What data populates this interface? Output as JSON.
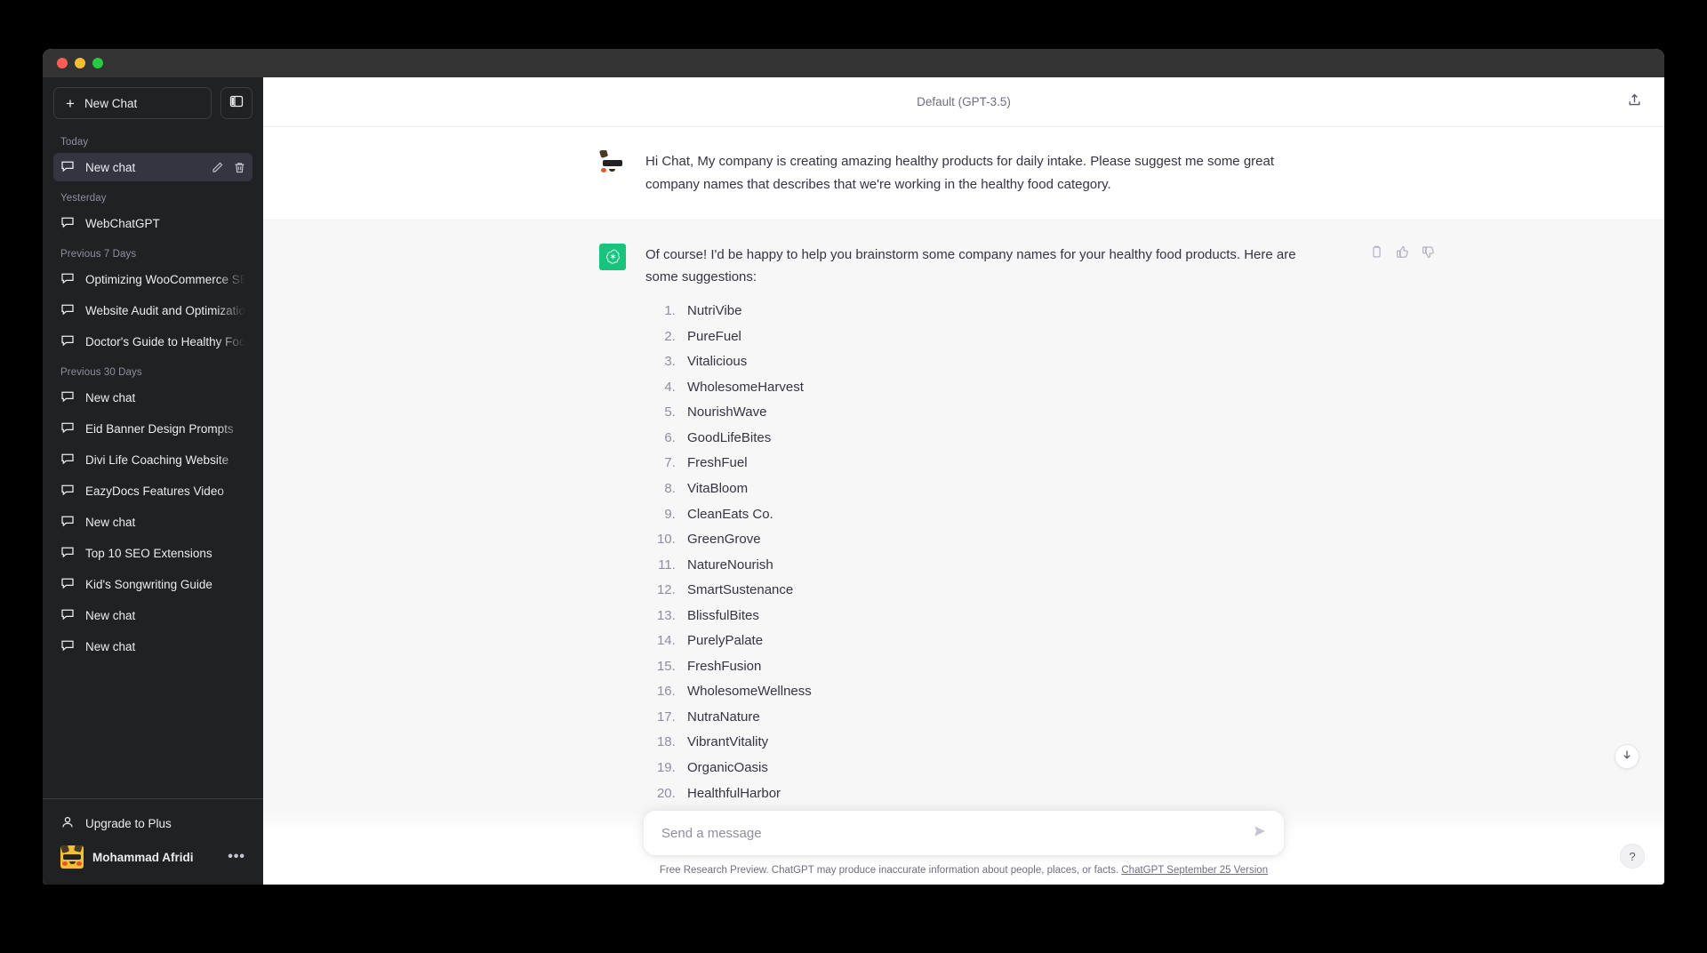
{
  "window": {
    "traffic_lights": [
      "close",
      "minimize",
      "maximize"
    ]
  },
  "sidebar": {
    "new_chat_label": "New Chat",
    "collapse_icon": "sidebar-toggle-icon",
    "sections": [
      {
        "label": "Today",
        "items": [
          {
            "title": "New chat",
            "active": true,
            "icon": "chat-bubble-icon"
          }
        ]
      },
      {
        "label": "Yesterday",
        "items": [
          {
            "title": "WebChatGPT",
            "active": false,
            "icon": "chat-bubble-icon"
          }
        ]
      },
      {
        "label": "Previous 7 Days",
        "items": [
          {
            "title": "Optimizing WooCommerce SEO Strategy",
            "active": false,
            "icon": "chat-bubble-icon"
          },
          {
            "title": "Website Audit and Optimization Plan",
            "active": false,
            "icon": "chat-bubble-icon"
          },
          {
            "title": "Doctor's Guide to Healthy Food",
            "active": false,
            "icon": "chat-bubble-icon"
          }
        ]
      },
      {
        "label": "Previous 30 Days",
        "items": [
          {
            "title": "New chat",
            "active": false,
            "icon": "chat-bubble-icon"
          },
          {
            "title": "Eid Banner Design Prompts",
            "active": false,
            "icon": "chat-bubble-icon"
          },
          {
            "title": "Divi Life Coaching Website",
            "active": false,
            "icon": "chat-bubble-icon"
          },
          {
            "title": "EazyDocs Features Video",
            "active": false,
            "icon": "chat-bubble-icon"
          },
          {
            "title": "New chat",
            "active": false,
            "icon": "chat-bubble-icon"
          },
          {
            "title": "Top 10 SEO Extensions",
            "active": false,
            "icon": "chat-bubble-icon"
          },
          {
            "title": "Kid's Songwriting Guide",
            "active": false,
            "icon": "chat-bubble-icon"
          },
          {
            "title": "New chat",
            "active": false,
            "icon": "chat-bubble-icon"
          },
          {
            "title": "New chat",
            "active": false,
            "icon": "chat-bubble-icon"
          }
        ]
      }
    ],
    "row_actions": [
      "edit-icon",
      "delete-icon"
    ],
    "footer": {
      "upgrade_label": "Upgrade to Plus",
      "upgrade_icon": "person-icon",
      "user_name": "Mohammad Afridi",
      "user_menu_icon": "ellipsis-icon"
    }
  },
  "header": {
    "model_title": "Default (GPT-3.5)",
    "share_icon": "share-upload-icon"
  },
  "conversation": {
    "messages": [
      {
        "role": "user",
        "avatar": "user-avatar",
        "text": "Hi Chat, My company is creating amazing healthy products for daily intake. Please suggest me some great company names that describes that we're working in the healthy food category."
      },
      {
        "role": "assistant",
        "avatar": "chatgpt-logo-icon",
        "text": "Of course! I'd be happy to help you brainstorm some company names for your healthy food products. Here are some suggestions:",
        "list": [
          "NutriVibe",
          "PureFuel",
          "Vitalicious",
          "WholesomeHarvest",
          "NourishWave",
          "GoodLifeBites",
          "FreshFuel",
          "VitaBloom",
          "CleanEats Co.",
          "GreenGrove",
          "NatureNourish",
          "SmartSustenance",
          "BlissfulBites",
          "PurelyPalate",
          "FreshFusion",
          "WholesomeWellness",
          "NutraNature",
          "VibrantVitality",
          "OrganicOasis",
          "HealthfulHarbor"
        ],
        "actions": [
          "copy-icon",
          "thumbs-up-icon",
          "thumbs-down-icon"
        ]
      }
    ]
  },
  "composer": {
    "placeholder": "Send a message",
    "value": "",
    "send_icon": "send-arrow-icon"
  },
  "footer_note": {
    "text": "Free Research Preview. ChatGPT may produce inaccurate information about people, places, or facts.",
    "link_text": "ChatGPT September 25 Version"
  },
  "floating": {
    "scroll_down_icon": "arrow-down-icon",
    "help_label": "?"
  },
  "colors": {
    "sidebar_bg": "#202123",
    "sidebar_active": "#343541",
    "titlebar_bg": "#333333",
    "assistant_row_bg": "#f7f7f8",
    "gpt_green": "#19c37d",
    "text_primary": "#343541",
    "text_muted": "#8e8ea0"
  }
}
